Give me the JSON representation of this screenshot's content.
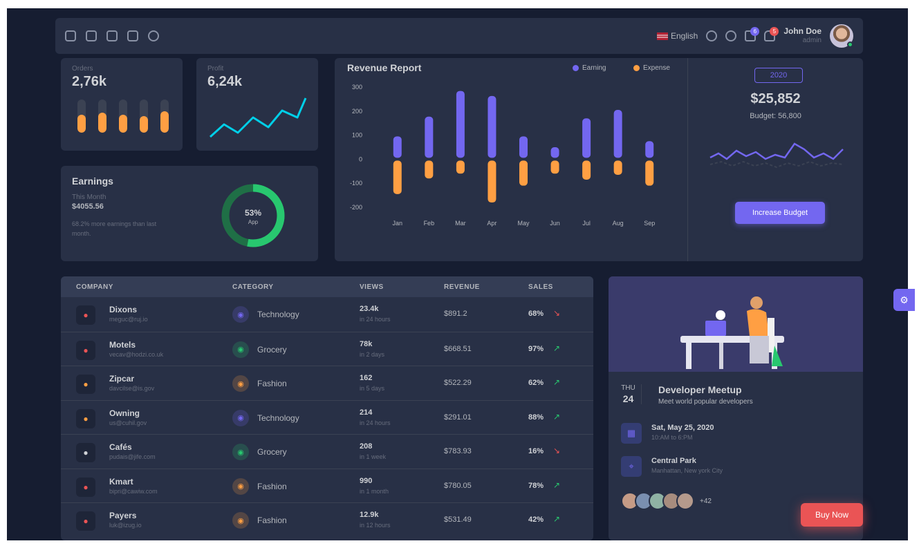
{
  "topbar": {
    "nav_icons": [
      "calendar-icon",
      "chat-icon",
      "mail-icon",
      "checkbox-icon",
      "star-icon"
    ],
    "language": "English",
    "icons": [
      "moon-icon",
      "search-icon",
      "cart-icon",
      "bell-icon"
    ],
    "cart_badge": "6",
    "bell_badge": "5",
    "user_name": "John Doe",
    "user_role": "admin"
  },
  "orders": {
    "title": "Orders",
    "value": "2,76k",
    "bar_levels": [
      0.55,
      0.6,
      0.55,
      0.5,
      0.65
    ]
  },
  "profit": {
    "title": "Profit",
    "value": "6,24k"
  },
  "earnings": {
    "title": "Earnings",
    "sub": "This Month",
    "value": "$4055.56",
    "note": "68.2% more earnings than last month.",
    "donut_label": "53%",
    "donut_sub": "App",
    "donut_percent": 53
  },
  "revenue": {
    "title": "Revenue Report",
    "legend_earning": "Earning",
    "legend_expense": "Expense",
    "year": "2020",
    "budget_value": "$25,852",
    "budget_label": "Budget: 56,800",
    "button": "Increase Budget"
  },
  "chart_data": {
    "type": "bar",
    "categories": [
      "Jan",
      "Feb",
      "Mar",
      "Apr",
      "May",
      "Jun",
      "Jul",
      "Aug",
      "Sep"
    ],
    "series": [
      {
        "name": "Earning",
        "values": [
          95,
          177,
          284,
          263,
          95,
          50,
          170,
          205,
          75
        ],
        "color": "#7367f0"
      },
      {
        "name": "Expense",
        "values": [
          -145,
          -80,
          -60,
          -180,
          -110,
          -60,
          -85,
          -65,
          -110
        ],
        "color": "#ff9f43"
      }
    ],
    "yticks": [
      "300",
      "200",
      "100",
      "0",
      "-100",
      "-200"
    ],
    "ylim": [
      -200,
      300
    ]
  },
  "table": {
    "headers": [
      "COMPANY",
      "CATEGORY",
      "VIEWS",
      "REVENUE",
      "SALES"
    ],
    "rows": [
      {
        "company": "Dixons",
        "email": "meguc@ruj.io",
        "logo_color": "#ea5455",
        "category": "Technology",
        "cat_color": "#7367f0",
        "views": "23.4k",
        "views_sub": "in 24 hours",
        "revenue": "$891.2",
        "sales": "68%",
        "trend": "down"
      },
      {
        "company": "Motels",
        "email": "vecav@hodzi.co.uk",
        "logo_color": "#ea5455",
        "category": "Grocery",
        "cat_color": "#28c76f",
        "views": "78k",
        "views_sub": "in 2 days",
        "revenue": "$668.51",
        "sales": "97%",
        "trend": "up"
      },
      {
        "company": "Zipcar",
        "email": "davcilse@is.gov",
        "logo_color": "#ff9f43",
        "category": "Fashion",
        "cat_color": "#ff9f43",
        "views": "162",
        "views_sub": "in 5 days",
        "revenue": "$522.29",
        "sales": "62%",
        "trend": "up"
      },
      {
        "company": "Owning",
        "email": "us@cuhil.gov",
        "logo_color": "#ff9f43",
        "category": "Technology",
        "cat_color": "#7367f0",
        "views": "214",
        "views_sub": "in 24 hours",
        "revenue": "$291.01",
        "sales": "88%",
        "trend": "up"
      },
      {
        "company": "Cafés",
        "email": "pudais@jife.com",
        "logo_color": "#d0d2d6",
        "category": "Grocery",
        "cat_color": "#28c76f",
        "views": "208",
        "views_sub": "in 1 week",
        "revenue": "$783.93",
        "sales": "16%",
        "trend": "down"
      },
      {
        "company": "Kmart",
        "email": "bipri@cawiw.com",
        "logo_color": "#ea5455",
        "category": "Fashion",
        "cat_color": "#ff9f43",
        "views": "990",
        "views_sub": "in 1 month",
        "revenue": "$780.05",
        "sales": "78%",
        "trend": "up"
      },
      {
        "company": "Payers",
        "email": "luk@izug.io",
        "logo_color": "#ea5455",
        "category": "Fashion",
        "cat_color": "#ff9f43",
        "views": "12.9k",
        "views_sub": "in 12 hours",
        "revenue": "$531.49",
        "sales": "42%",
        "trend": "up"
      }
    ]
  },
  "meetup": {
    "month": "THU",
    "day": "24",
    "title": "Developer Meetup",
    "desc": "Meet world popular developers",
    "date_title": "Sat, May 25, 2020",
    "date_sub": "10:AM to 6:PM",
    "place_title": "Central Park",
    "place_sub": "Manhattan, New york City",
    "more": "+42"
  },
  "buy_now": "Buy Now"
}
